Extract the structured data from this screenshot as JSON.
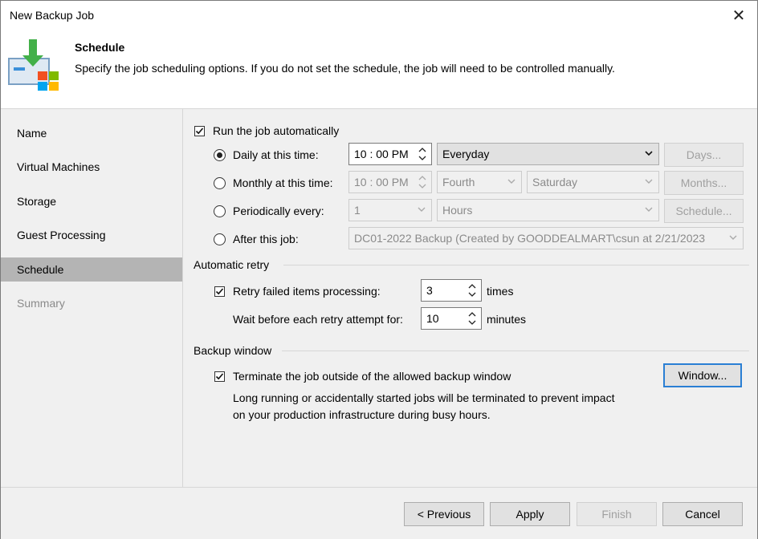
{
  "window": {
    "title": "New Backup Job",
    "close_glyph": "✕"
  },
  "header": {
    "icon": "backup-job-wizard-icon",
    "title": "Schedule",
    "description": "Specify the job scheduling options. If you do not set the schedule, the job will need to be controlled manually."
  },
  "sidebar": {
    "items": [
      {
        "label": "Name",
        "state": "normal"
      },
      {
        "label": "Virtual Machines",
        "state": "normal"
      },
      {
        "label": "Storage",
        "state": "normal"
      },
      {
        "label": "Guest Processing",
        "state": "normal"
      },
      {
        "label": "Schedule",
        "state": "active"
      },
      {
        "label": "Summary",
        "state": "disabled"
      }
    ]
  },
  "schedule": {
    "run_auto_label": "Run the job automatically",
    "run_auto_checked": true,
    "daily": {
      "label": "Daily at this time:",
      "time": "10 : 00  PM",
      "option": "Everyday",
      "button": "Days..."
    },
    "monthly": {
      "label": "Monthly at this time:",
      "time": "10 : 00  PM",
      "week": "Fourth",
      "day": "Saturday",
      "button": "Months..."
    },
    "periodically": {
      "label": "Periodically every:",
      "value": "1",
      "unit": "Hours",
      "button": "Schedule..."
    },
    "after": {
      "label": "After this job:",
      "job": "DC01-2022 Backup (Created by GOODDEALMART\\csun at 2/21/2023"
    },
    "selected": "daily"
  },
  "retry": {
    "section_title": "Automatic retry",
    "retry_label": "Retry failed items processing:",
    "retry_checked": true,
    "retry_count": "3",
    "retry_unit": "times",
    "wait_label": "Wait before each retry attempt for:",
    "wait_value": "10",
    "wait_unit": "minutes"
  },
  "backup_window": {
    "section_title": "Backup window",
    "terminate_label": "Terminate the job outside of the allowed backup window",
    "terminate_checked": true,
    "button": "Window...",
    "note_line1": "Long running or accidentally started jobs will be terminated to prevent impact",
    "note_line2": "on your production infrastructure during busy hours."
  },
  "footer": {
    "previous": "< Previous",
    "apply": "Apply",
    "finish": "Finish",
    "cancel": "Cancel"
  }
}
